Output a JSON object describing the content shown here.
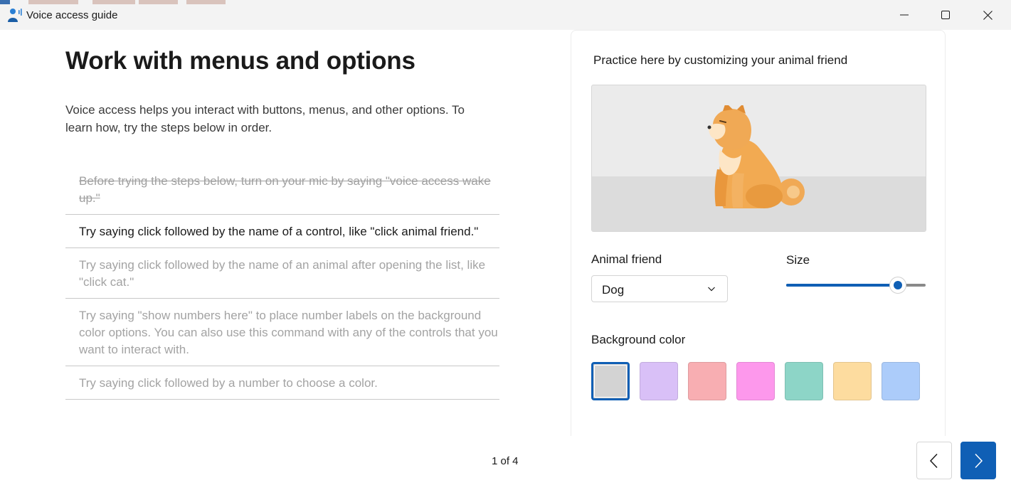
{
  "window": {
    "title": "Voice access guide",
    "icon": "voice-access-app-icon",
    "controls": [
      "minimize-icon",
      "maximize-icon",
      "close-icon"
    ]
  },
  "guide": {
    "title": "Work with menus and options",
    "intro": "Voice access helps you interact with buttons, menus, and other options. To learn how, try the steps below in order.",
    "steps": [
      {
        "text": "Before trying the steps below, turn on your mic by saying \"voice access wake up.\"",
        "state": "done"
      },
      {
        "text": "Try saying click followed by the name of a control, like \"click animal friend.\"",
        "state": "active"
      },
      {
        "text": "Try saying click followed by the name of an animal after opening the list, like \"click cat.\"",
        "state": "pending"
      },
      {
        "text": "Try saying \"show numbers here\" to place number labels on the background color options. You can also use this command with any of the controls that you want to interact with.",
        "state": "pending"
      },
      {
        "text": "Try saying click followed by a number to choose a color.",
        "state": "pending"
      }
    ]
  },
  "practice": {
    "title": "Practice here by customizing your animal friend",
    "animal_image": "shiba-dog-illustration",
    "animal_friend": {
      "label": "Animal friend",
      "value": "Dog"
    },
    "size": {
      "label": "Size",
      "value_percent": 80
    },
    "background_color": {
      "label": "Background color",
      "selected_index": 0,
      "colors": [
        "#d3d3d3",
        "#d9c0f7",
        "#f8aeb2",
        "#fd98ec",
        "#8dd5c7",
        "#fddc9f",
        "#acccfa"
      ]
    }
  },
  "footer": {
    "page_indicator": "1 of 4",
    "prev_icon": "chevron-left-icon",
    "next_icon": "chevron-right-icon"
  },
  "colors": {
    "accent": "#0f5fb5",
    "text_muted": "#a3a3a3"
  }
}
